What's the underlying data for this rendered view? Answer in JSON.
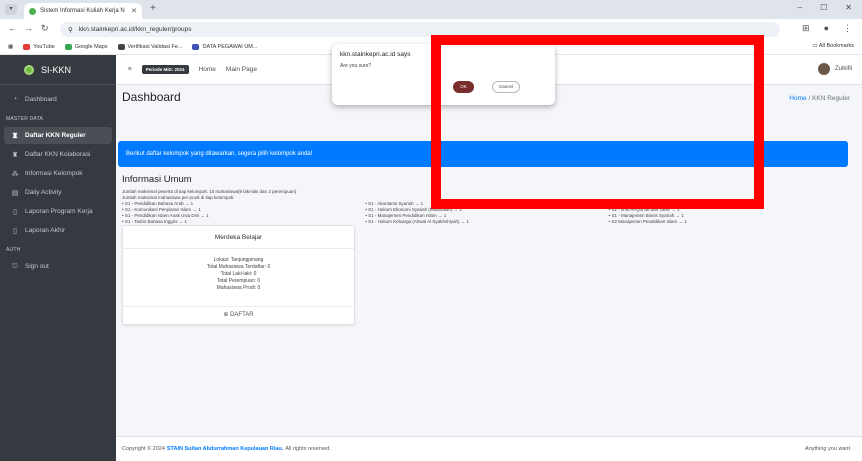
{
  "browser": {
    "tab_title": "Sistem Informasi Kuliah Kerja N",
    "url": "kkn.stainkepri.ac.id/kkn_reguler/groups",
    "bookmarks": [
      "YouTube",
      "Google Maps",
      "Verifikasi Validasi Fe...",
      "DATA PEGAWAI UM..."
    ],
    "all_bookmarks": "All Bookmarks",
    "colors": {
      "tab_icon": "#4caf50"
    }
  },
  "sidebar": {
    "brand": "SI-KKN",
    "items": [
      {
        "label": "Dashboard",
        "icon": "dashboard-icon"
      },
      {
        "header": "MASTER DATA"
      },
      {
        "label": "Daftar KKN Reguler",
        "icon": "user-icon",
        "active": true
      },
      {
        "label": "Daftar KKN Kolaborasi",
        "icon": "user-icon"
      },
      {
        "label": "Informasi Kelompok",
        "icon": "group-icon"
      },
      {
        "label": "Daily Activity",
        "icon": "calendar-icon"
      },
      {
        "label": "Laporan Program Kerja",
        "icon": "document-icon"
      },
      {
        "label": "Laporan Akhir",
        "icon": "document-icon"
      },
      {
        "header": "AUTH"
      },
      {
        "label": "Sign out",
        "icon": "signout-icon"
      }
    ]
  },
  "topnav": {
    "badge": "Periode MiD: 2024",
    "links": [
      "Home",
      "Main Page"
    ],
    "user": "Zulkifli"
  },
  "content": {
    "title": "Dashboard",
    "breadcrumb_home": "Home",
    "breadcrumb_current": "KKN Reguler",
    "alert": "Berikut daftar kelompok yang ditawarkan, segera pilih kelompok anda!",
    "info_title": "Informasi Umum",
    "info_line1": "Jumlah maksimal peserta di tiap kelompok: 10 mahasiswa(9 laki-laki dan 2 perempuan)",
    "info_line2": "Jumlah maksimal mahasiswa per prodi di tiap kelompok:",
    "prodi_col1": [
      "S1 - Pendidikan Bahasa Arab → 1",
      "S1 - Komunikasi Penyiaran Islam → 1",
      "S1 - Pendidikan Islam Anak Usia Dini → 1",
      "S1 - Tadris Bahasa Inggris → 1"
    ],
    "prodi_col2": [
      "S1 - Akuntansi Syariah → 1",
      "S1 - Hukum Ekonomi Syariah (Muamalah) → 1",
      "S1 - Manajemen Pendidikan Islam → 1",
      "S1 - Hukum Keluarga (Ahwal Al Syakhshiyah) → 1"
    ],
    "prodi_col3": [
      "S1 - Pendidikan Agama Islam → 1",
      "S1 - Ilmu Al-Qur'an dan Tafsir → 1",
      "S1 - Manajemen Bisnis Syariah → 1",
      "S2 Manajemen Pendidikan Islam → 1"
    ],
    "card": {
      "title": "Merdeka Belajar",
      "lokasi": "Lokasi: Tanjungpinang",
      "total_mhs": "Total Mahasiswa Terdaftar: 0",
      "total_laki": "Total Laki-laki: 0",
      "total_perempuan": "Total Perempuan: 0",
      "mhs_prodi": "Mahasiswa Prodi: 0",
      "button": "DAFTAR"
    }
  },
  "footer": {
    "prefix": "Copyright © 2024",
    "org": "STAIN Sultan Abdurrahman Kepulauan Riau.",
    "suffix": "All rights reserved.",
    "right": "Anything you want"
  },
  "dialog": {
    "title": "kkn.stainkepri.ac.id says",
    "message": "Are you sure?",
    "ok": "OK",
    "cancel": "Cancel",
    "colors": {
      "ok_button": "#7a2d2d",
      "highlight": "#ff0000"
    }
  }
}
